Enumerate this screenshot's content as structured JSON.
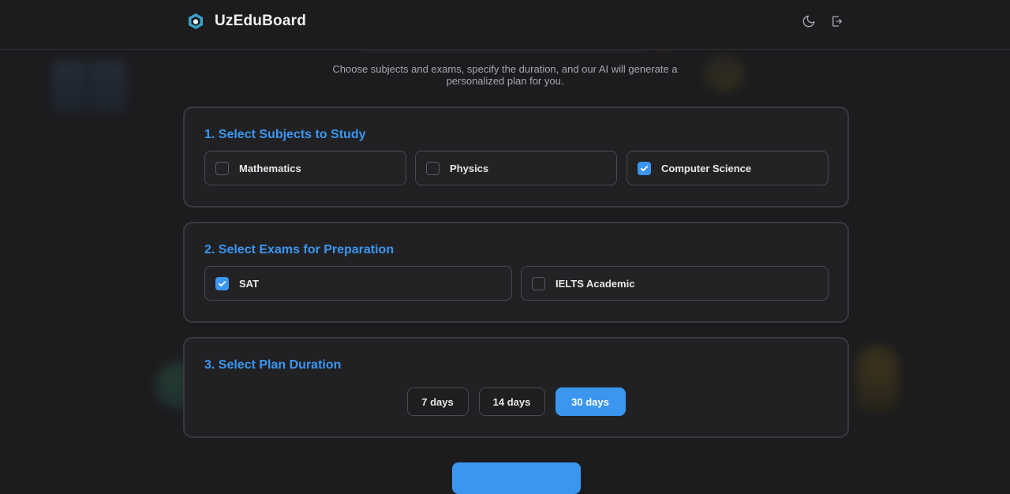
{
  "header": {
    "brand_name": "UzEduBoard",
    "icons": [
      "moon-icon",
      "logout-icon"
    ]
  },
  "intro": {
    "subtitle_line1": "Choose subjects and exams, specify the duration, and our AI will generate a",
    "subtitle_line2": "personalized plan for you."
  },
  "subjects": {
    "title": "1. Select Subjects to Study",
    "items": [
      {
        "label": "Mathematics",
        "checked": false
      },
      {
        "label": "Physics",
        "checked": false
      },
      {
        "label": "Computer Science",
        "checked": true
      }
    ]
  },
  "exams": {
    "title": "2. Select Exams for Preparation",
    "items": [
      {
        "label": "SAT",
        "checked": true
      },
      {
        "label": "IELTS Academic",
        "checked": false
      }
    ]
  },
  "duration": {
    "title": "3. Select Plan Duration",
    "options": [
      {
        "label": "7 days",
        "selected": false
      },
      {
        "label": "14 days",
        "selected": false
      },
      {
        "label": "30 days",
        "selected": true
      }
    ]
  },
  "colors": {
    "accent": "#3b96f0",
    "background": "#1c1c1e",
    "card": "#212124"
  }
}
